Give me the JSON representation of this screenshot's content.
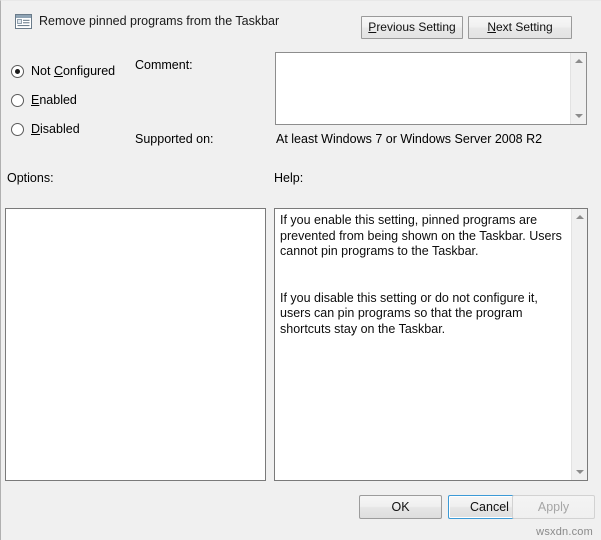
{
  "window": {
    "title": "Remove pinned programs from the Taskbar",
    "icon": "policy-setting-icon"
  },
  "header": {
    "previous_setting_label": "Previous Setting",
    "previous_setting_accel": "P",
    "next_setting_label": "Next Setting",
    "next_setting_accel": "N"
  },
  "state": {
    "selected": "Not Configured",
    "options": [
      {
        "label": "Not Configured",
        "accel": "C",
        "checked": true
      },
      {
        "label": "Enabled",
        "accel": "E",
        "checked": false
      },
      {
        "label": "Disabled",
        "accel": "D",
        "checked": false
      }
    ]
  },
  "comment": {
    "label": "Comment:",
    "value": "",
    "placeholder": ""
  },
  "supported": {
    "label": "Supported on:",
    "value": "At least Windows 7 or Windows Server 2008 R2"
  },
  "options_section": {
    "label": "Options:",
    "items": []
  },
  "help_section": {
    "label": "Help:",
    "text": "If you enable this setting, pinned programs are prevented from being shown on the Taskbar. Users cannot pin programs to the Taskbar.\n\n\nIf you disable this setting or do not configure it, users can pin programs so that the program shortcuts stay on the Taskbar."
  },
  "footer": {
    "ok_label": "OK",
    "cancel_label": "Cancel",
    "apply_label": "Apply",
    "apply_disabled": true,
    "focused_button": "Cancel"
  },
  "watermark": {
    "text": "wsxdn.com"
  },
  "colors": {
    "dialog_background": "#f0f0f0",
    "field_background": "#ffffff",
    "border": "#8d8d8d",
    "focus_accent": "#3c9ad6",
    "disabled_text": "#a6a6a6",
    "text": "#101010"
  }
}
